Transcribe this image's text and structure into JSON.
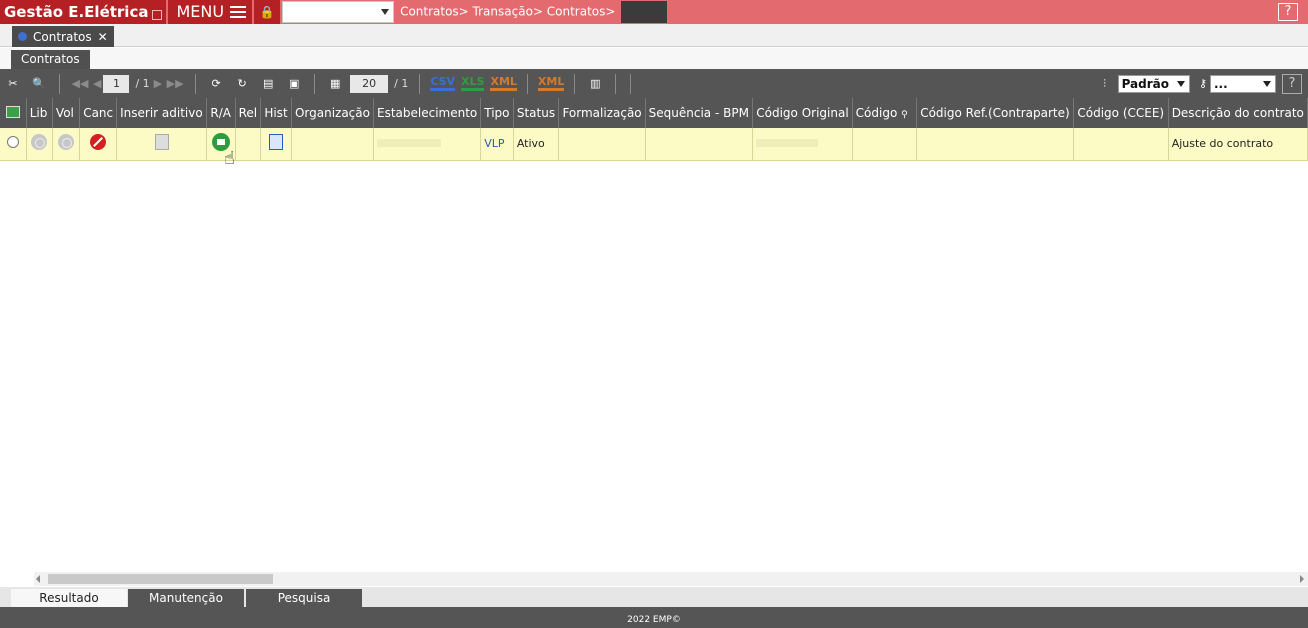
{
  "topbar": {
    "app_title": "Gestão E.Elétrica",
    "menu_label": "MENU",
    "breadcrumb": "Contratos> Transação> Contratos>",
    "help": "?"
  },
  "tabs": {
    "document_tab": "Contratos",
    "close_symbol": "✕",
    "sub_tab": "Contratos"
  },
  "toolbar": {
    "page_current": "1",
    "page_total": "/ 1",
    "rows_per_page": "20",
    "rows_total": "/ 1",
    "csv": "CSV",
    "xls": "XLS",
    "xml": "XML",
    "xml2": "XML",
    "view_select": "Padrão",
    "search_select": "...",
    "help": "?"
  },
  "table": {
    "headers": [
      "Lib",
      "Vol",
      "Canc",
      "Inserir aditivo",
      "R/A",
      "Rel",
      "Hist",
      "Organização",
      "Estabelecimento",
      "Tipo",
      "Status",
      "Formalização",
      "Sequência - BPM",
      "Código Original",
      "Código",
      "Código Ref.(Contraparte)",
      "Código (CCEE)",
      "Descrição do contrato"
    ],
    "rows": [
      {
        "tipo": "VLP",
        "status": "Ativo",
        "descricao": "Ajuste do contrato"
      }
    ]
  },
  "bottom_tabs": [
    "Resultado",
    "Manutenção",
    "Pesquisa"
  ],
  "footer": "2022 EMP©"
}
